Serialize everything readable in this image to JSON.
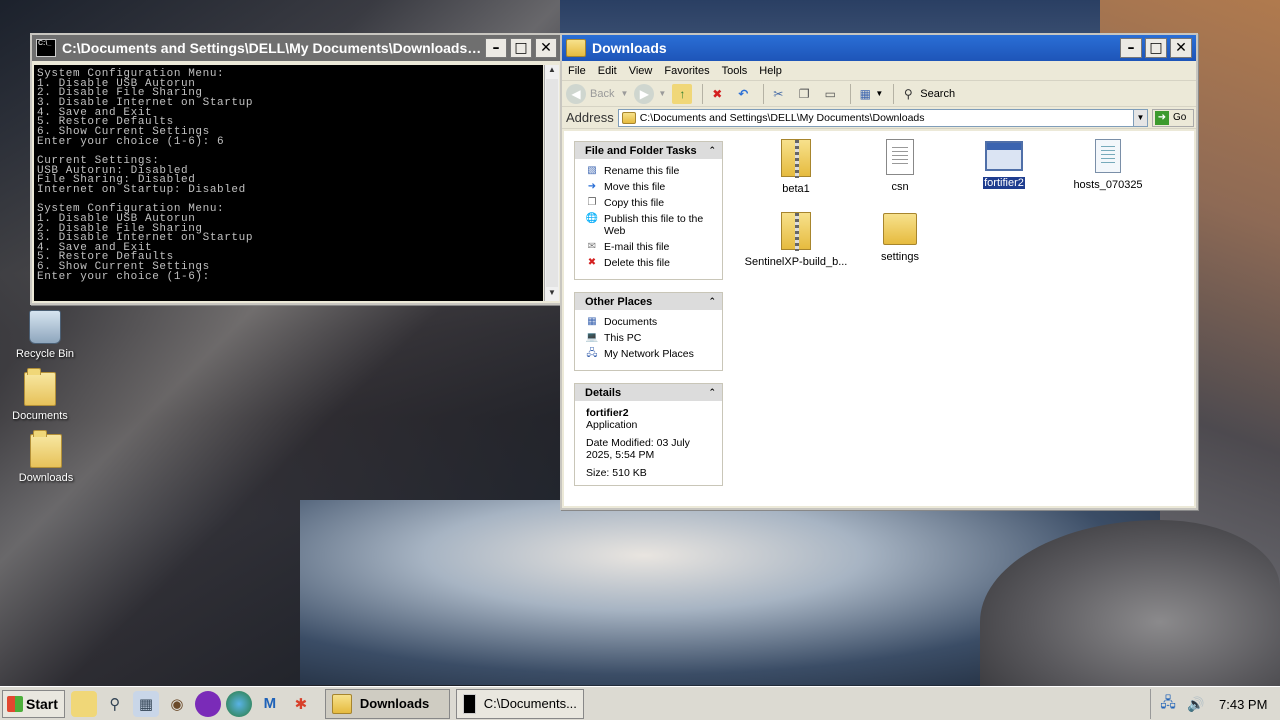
{
  "desktop": {
    "icons": [
      {
        "label": "Recycle Bin"
      },
      {
        "label": "Documents"
      },
      {
        "label": "Downloads"
      }
    ]
  },
  "console": {
    "title": "C:\\Documents and Settings\\DELL\\My Documents\\Downloads\\...",
    "icon_text": "C:\\_",
    "output": "System Configuration Menu:\n1. Disable USB Autorun\n2. Disable File Sharing\n3. Disable Internet on Startup\n4. Save and Exit\n5. Restore Defaults\n6. Show Current Settings\nEnter your choice (1-6): 6\n\nCurrent Settings:\nUSB Autorun: Disabled\nFile Sharing: Disabled\nInternet on Startup: Disabled\n\nSystem Configuration Menu:\n1. Disable USB Autorun\n2. Disable File Sharing\n3. Disable Internet on Startup\n4. Save and Exit\n5. Restore Defaults\n6. Show Current Settings\nEnter your choice (1-6):"
  },
  "explorer": {
    "title": "Downloads",
    "menu": [
      "File",
      "Edit",
      "View",
      "Favorites",
      "Tools",
      "Help"
    ],
    "toolbar": {
      "back_label": "Back",
      "search_label": "Search"
    },
    "address": {
      "label": "Address",
      "value": "C:\\Documents and Settings\\DELL\\My Documents\\Downloads",
      "go_label": "Go"
    },
    "file_tasks": {
      "header": "File and Folder Tasks",
      "items": [
        {
          "label": "Rename this file"
        },
        {
          "label": "Move this file"
        },
        {
          "label": "Copy this file"
        },
        {
          "label": "Publish this file to the Web"
        },
        {
          "label": "E-mail this file"
        },
        {
          "label": "Delete this file"
        }
      ]
    },
    "other_places": {
      "header": "Other Places",
      "items": [
        {
          "label": "Documents"
        },
        {
          "label": "This PC"
        },
        {
          "label": "My Network Places"
        }
      ]
    },
    "details": {
      "header": "Details",
      "name": "fortifier2",
      "type": "Application",
      "modified": "Date Modified: 03 July 2025, 5:54 PM",
      "size": "Size: 510 KB"
    },
    "files": [
      {
        "name": "beta1",
        "kind": "zip-folder"
      },
      {
        "name": "csn",
        "kind": "text-document"
      },
      {
        "name": "fortifier2",
        "kind": "application",
        "selected": true
      },
      {
        "name": "hosts_070325",
        "kind": "config-file"
      },
      {
        "name": "SentinelXP-build_b...",
        "kind": "zip-folder"
      },
      {
        "name": "settings",
        "kind": "folder"
      }
    ]
  },
  "taskbar": {
    "start_label": "Start",
    "tasks": [
      {
        "label": "Downloads",
        "active": true
      },
      {
        "label": "C:\\Documents...",
        "active": false
      }
    ],
    "clock": "7:43 PM"
  }
}
